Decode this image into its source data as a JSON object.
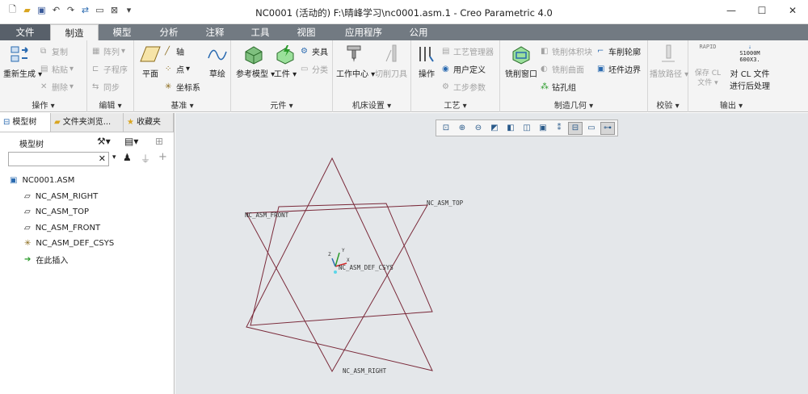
{
  "window": {
    "title": "NC0001 (活动的) F:\\晴峰学习\\nc0001.asm.1 - Creo Parametric 4.0"
  },
  "tabs": [
    "文件",
    "制造",
    "模型",
    "分析",
    "注释",
    "工具",
    "视图",
    "应用程序",
    "公用"
  ],
  "groups": {
    "ops": "操作",
    "edit": "编辑",
    "datum": "基准",
    "comp": "元件",
    "machine": "机床设置",
    "process": "工艺",
    "mfg_geom": "制造几何",
    "verify": "校验",
    "output": "输出"
  },
  "ribbon": {
    "regen": "重新生成",
    "copy": "复制",
    "paste": "粘贴",
    "delete": "删除",
    "array": "阵列",
    "subprog": "子程序",
    "sync": "同步",
    "plane": "平面",
    "axis": "轴",
    "point": "点",
    "csys": "坐标系",
    "sketch": "草绘",
    "ref_model": "参考模型",
    "workpiece": "工件",
    "fixture": "夹具",
    "classify": "分类",
    "work_center": "工作中心",
    "cut_tool": "切削刀具",
    "operation": "操作",
    "proc_mgr": "工艺管理器",
    "user_def": "用户定义",
    "step_param": "工步参数",
    "mill_window": "铣削窗口",
    "mill_volume": "铣削体积块",
    "mill_surface": "铣削曲面",
    "drill_group": "钻孔组",
    "turn_profile": "车削轮廓",
    "stock_boundary": "坯件边界",
    "play_path": "播放路径",
    "rapid_l1": "RAPID",
    "rapid_l2": "FEDRAT",
    "s_l1": "S1000M",
    "s_l2": "600X3.",
    "save_cl": "保存 CL",
    "file": "文件",
    "post_l1": "对 CL 文件",
    "post_l2": "进行后处理"
  },
  "left": {
    "tab1": "模型树",
    "tab2": "文件夹浏览...",
    "tab3": "收藏夹",
    "tree_label": "模型树",
    "items": [
      "NC0001.ASM",
      "NC_ASM_RIGHT",
      "NC_ASM_TOP",
      "NC_ASM_FRONT",
      "NC_ASM_DEF_CSYS",
      "在此插入"
    ]
  },
  "canvas": {
    "label_front": "NC_ASM_FRONT",
    "label_top": "NC_ASM_TOP",
    "label_right": "NC_ASM_RIGHT",
    "label_csys": "NC_ASM_DEF_CSYS",
    "axis_x": "X",
    "axis_y": "Y",
    "axis_z": "Z"
  },
  "colors": {
    "datum": "#7a2a3a",
    "tabbar": "#727a82",
    "canvas": "#e4e7ea"
  }
}
